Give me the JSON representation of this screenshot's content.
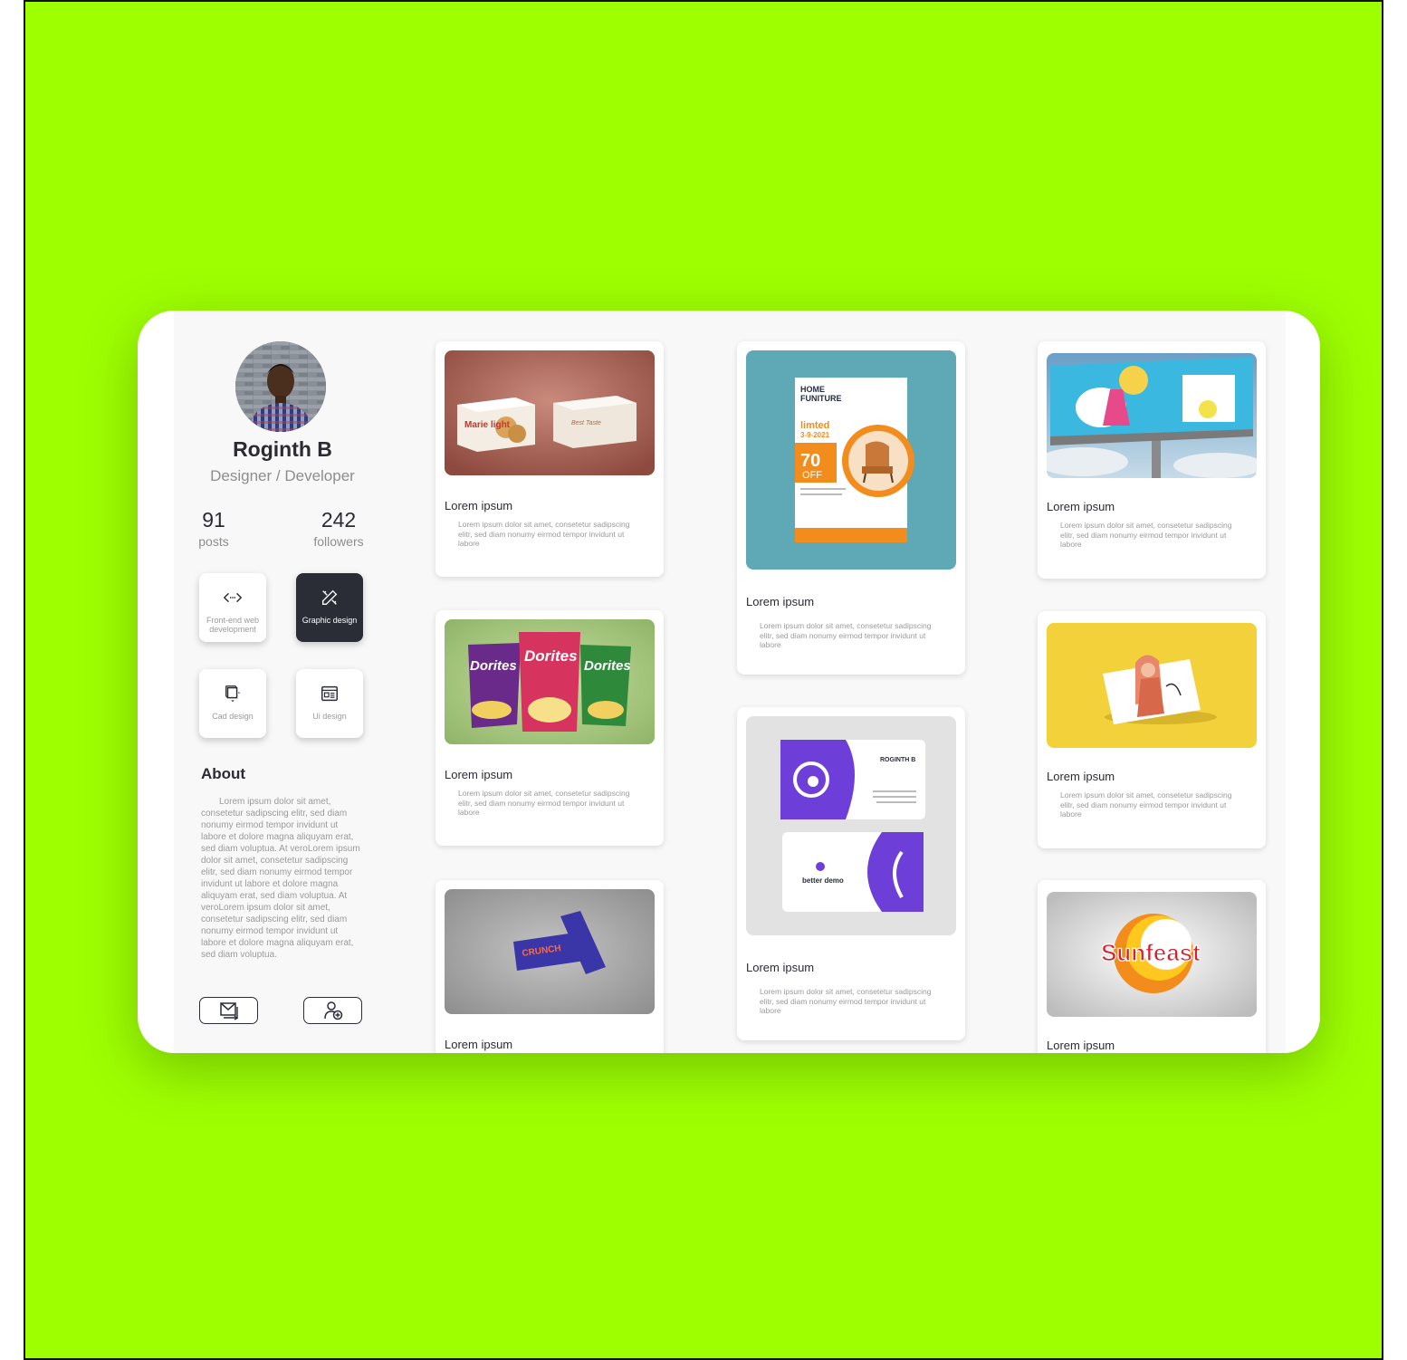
{
  "profile": {
    "name": "Roginth B",
    "role": "Designer / Developer",
    "posts_count": "91",
    "posts_label": "posts",
    "followers_count": "242",
    "followers_label": "followers"
  },
  "skills": [
    {
      "label": "Front-end web development",
      "icon": "code-icon",
      "active": false
    },
    {
      "label": "Graphic design",
      "icon": "pen-ruler-icon",
      "active": true
    },
    {
      "label": "Cad design",
      "icon": "cube-icon",
      "active": false
    },
    {
      "label": "Ui design",
      "icon": "layout-icon",
      "active": false
    }
  ],
  "about": {
    "heading": "About",
    "text": "Lorem ipsum dolor sit amet, consetetur sadipscing elitr, sed diam nonumy eirmod tempor invidunt ut labore et dolore magna aliquyam erat, sed diam voluptua. At veroLorem ipsum dolor sit amet, consetetur sadipscing elitr, sed diam nonumy eirmod tempor invidunt ut labore et dolore magna aliquyam erat, sed diam voluptua. At veroLorem ipsum dolor sit amet, consetetur sadipscing elitr, sed diam nonumy eirmod tempor invidunt ut labore et dolore magna aliquyam erat, sed diam voluptua."
  },
  "actions": {
    "message_icon": "mail-icon",
    "follow_icon": "add-user-icon"
  },
  "cards": [
    {
      "title": "Lorem ipsum",
      "desc": "Lorem ipsum dolor sit amet, consetetur sadipscing elitr, sed diam nonumy eirmod tempor invidunt ut labore",
      "image": "Marie light biscuit box mockup",
      "brand": "Marie light"
    },
    {
      "title": "Lorem ipsum",
      "desc": "Lorem ipsum dolor sit amet, consetetur sadipscing elitr, sed diam nonumy eirmod tempor invidunt ut labore",
      "image": "Doritos chips packets",
      "brand": "Dorites"
    },
    {
      "title": "Lorem ipsum",
      "desc": "",
      "image": "Crunch chocolate bars",
      "brand": "CRUNCH"
    },
    {
      "title": "Lorem ipsum",
      "desc": "Lorem ipsum dolor sit amet, consetetur sadipscing elitr, sed diam nonumy eirmod tempor invidunt ut labore",
      "image": "Home furniture flyer",
      "flyer": {
        "line1": "HOME",
        "line2": "FUNITURE",
        "tag": "limted",
        "date": "3-9-2021",
        "pct": "70",
        "off": "OFF"
      }
    },
    {
      "title": "Lorem ipsum",
      "desc": "Lorem ipsum dolor sit amet, consetetur sadipscing elitr, sed diam nonumy eirmod tempor invidunt ut labore",
      "image": "Better demo business card",
      "card_name": "ROGINTH B",
      "card_brand": "better demo"
    },
    {
      "title": "Lorem ipsum",
      "desc": "Lorem ipsum dolor sit amet, consetetur sadipscing elitr, sed diam nonumy eirmod tempor invidunt ut labore",
      "image": "POW billboard"
    },
    {
      "title": "Lorem ipsum",
      "desc": "Lorem ipsum dolor sit amet, consetetur sadipscing elitr, sed diam nonumy eirmod tempor invidunt ut labore",
      "image": "Illustrated character card on yellow"
    },
    {
      "title": "Lorem ipsum",
      "desc": "",
      "image": "Sunfeast logo",
      "brand": "Sunfeast"
    }
  ],
  "colors": {
    "background": "#9eff00",
    "dark": "#2a2c36",
    "panel": "#f8f8f8",
    "flyer_orange": "#f28c1c",
    "card_purple": "#6e3fd8",
    "billboard_yellow": "#f3d13a"
  }
}
